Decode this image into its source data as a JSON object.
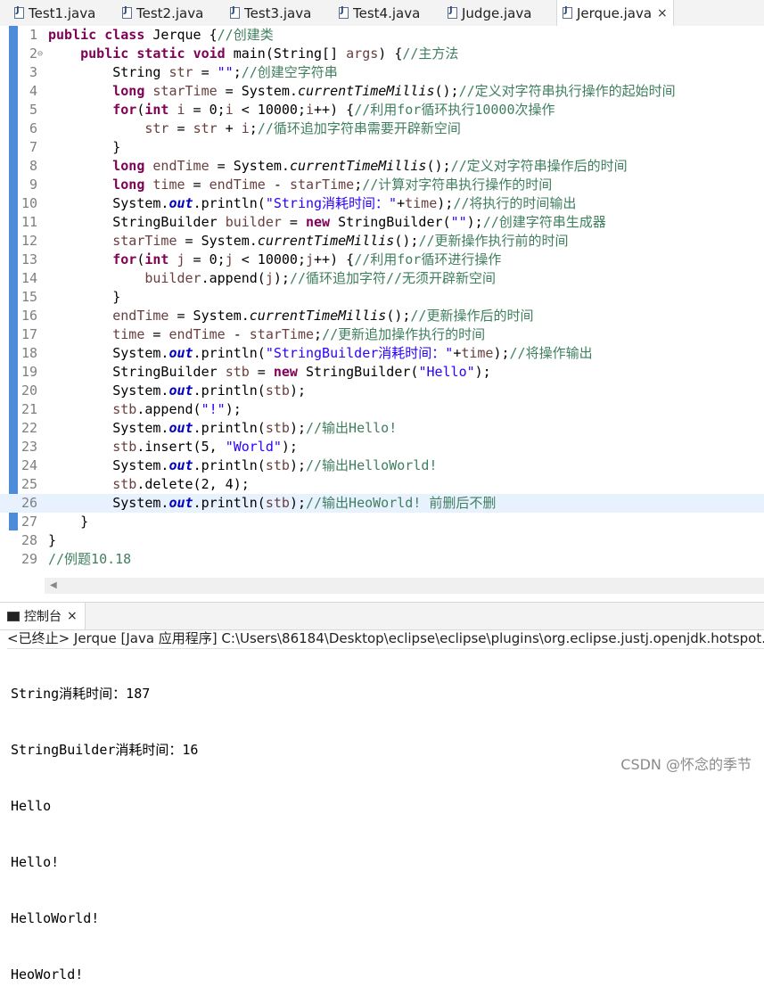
{
  "tabs": [
    {
      "label": "Test1.java"
    },
    {
      "label": "Test2.java"
    },
    {
      "label": "Test3.java"
    },
    {
      "label": "Test4.java"
    },
    {
      "label": "Judge.java"
    },
    {
      "label": "Jerque.java",
      "active": true,
      "close": "×"
    }
  ],
  "editor": {
    "highlighted_line": 26,
    "line_numbers": [
      "1",
      "2",
      "3",
      "4",
      "5",
      "6",
      "7",
      "8",
      "9",
      "10",
      "11",
      "12",
      "13",
      "14",
      "15",
      "16",
      "17",
      "18",
      "19",
      "20",
      "21",
      "22",
      "23",
      "24",
      "25",
      "26",
      "27",
      "28",
      "29"
    ],
    "fold_marker": "⊖"
  },
  "console": {
    "tab_label": "控制台",
    "tab_close": "×",
    "status": "<已终止> Jerque [Java 应用程序] C:\\Users\\86184\\Desktop\\eclipse\\eclipse\\plugins\\org.eclipse.justj.openjdk.hotspot.jre",
    "output": [
      "String消耗时间：187",
      "StringBuilder消耗时间：16",
      "Hello",
      "Hello!",
      "HelloWorld!",
      "HeoWorld!"
    ]
  },
  "watermark": "CSDN @怀念的季节",
  "colors": {
    "keyword": "#7f0055",
    "comment": "#3f7f5f",
    "string": "#2a00ff",
    "field": "#0000c0",
    "highlight_line": "#e8f2fe",
    "gutter_change": "#4c8cd8"
  }
}
